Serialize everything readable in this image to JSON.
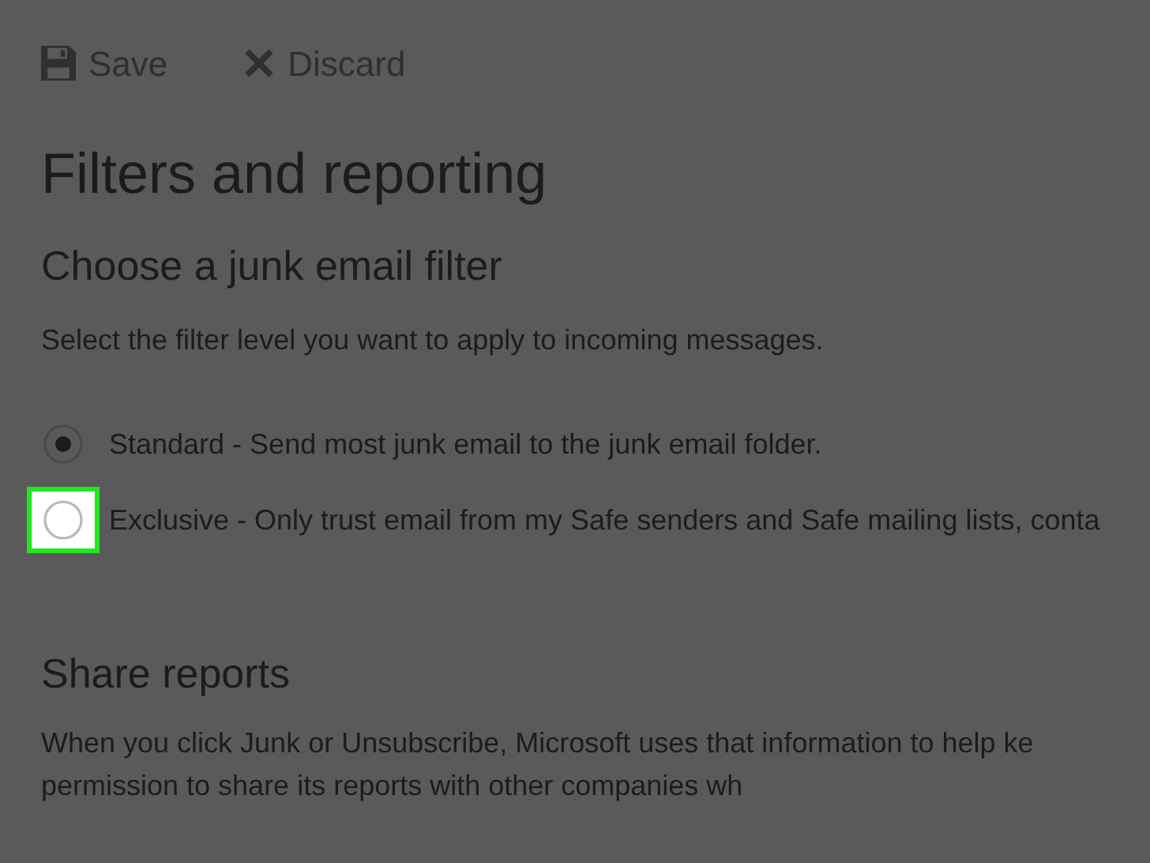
{
  "toolbar": [
    {
      "kind": "save",
      "label": "Save",
      "disabled": true
    },
    {
      "kind": "discard",
      "label": "Discard",
      "disabled": true
    }
  ],
  "title": "Filters and reporting",
  "junk_filter": {
    "heading": "Choose a junk email filter",
    "description": "Select the filter level you want to apply to incoming messages.",
    "options": [
      {
        "label": "Standard - Send most junk email to the junk email folder.",
        "selected": true,
        "highlighted": false
      },
      {
        "label": "Exclusive - Only trust email from my Safe senders and Safe mailing lists, conta",
        "selected": false,
        "highlighted": true
      }
    ]
  },
  "share_reports": {
    "heading": "Share reports",
    "lines": [
      "When you click Junk or Unsubscribe, Microsoft uses that information to help ke",
      "permission to share its reports with other companies wh"
    ]
  }
}
